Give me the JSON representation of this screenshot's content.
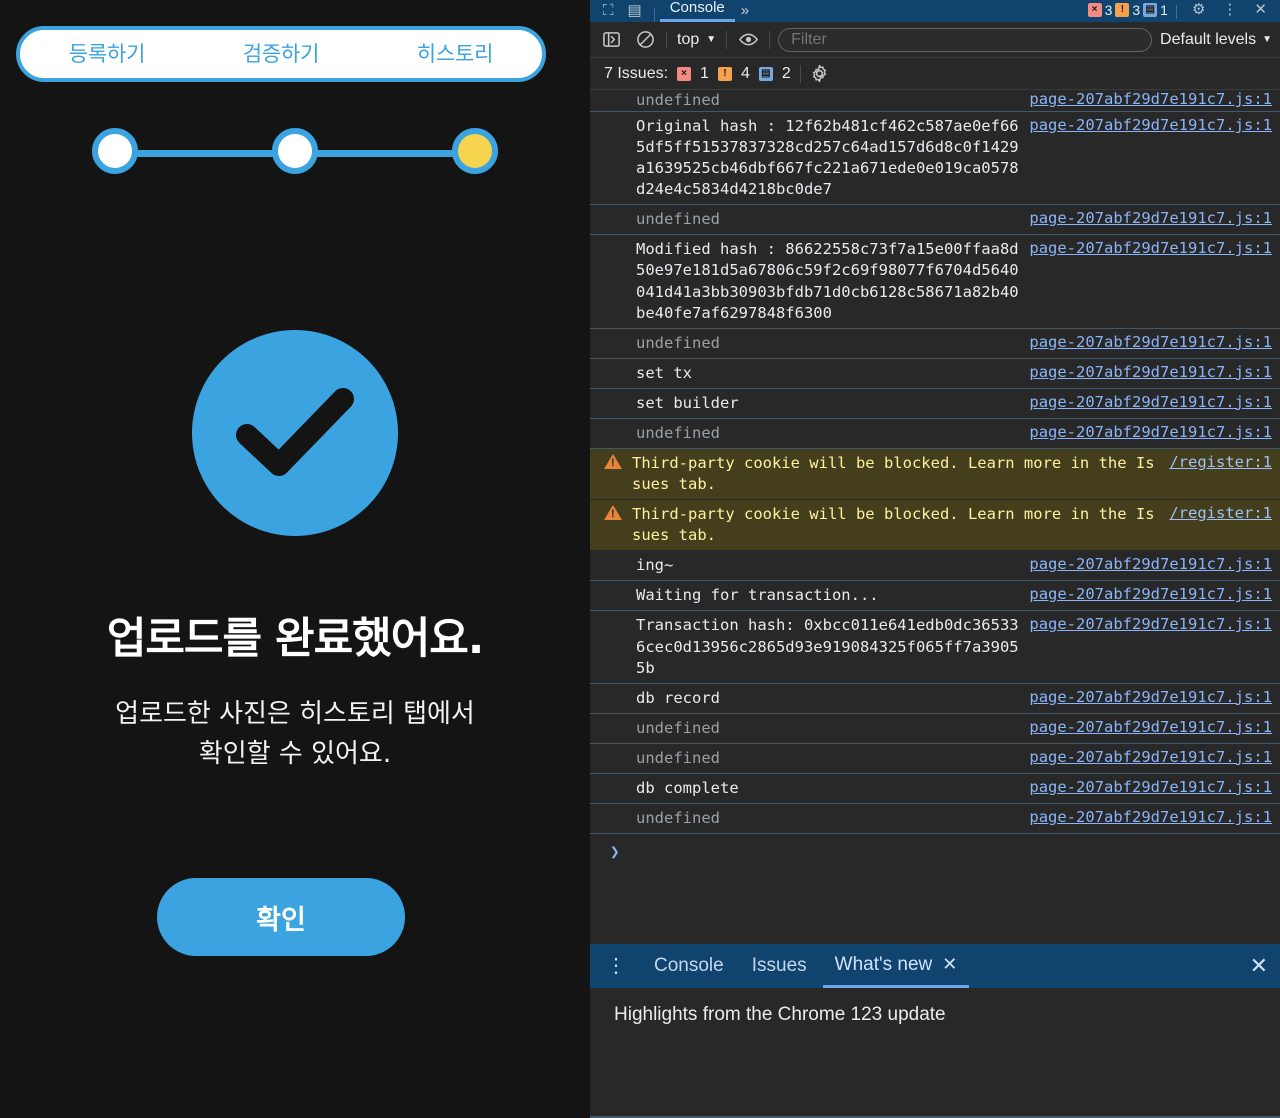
{
  "app": {
    "tabs": [
      {
        "label": "등록하기",
        "active": false
      },
      {
        "label": "검증하기",
        "active": false
      },
      {
        "label": "히스토리",
        "active": true
      }
    ],
    "stepper": {
      "steps": 3,
      "current_index": 2,
      "done_color": "#ffffff",
      "current_color": "#f6d44d",
      "accent": "#3ba3e0"
    },
    "status_icon": "check-circle-icon",
    "headline": "업로드를 완료했어요.",
    "subline_line1": "업로드한 사진은 히스토리 탭에서",
    "subline_line2": "확인할 수 있어요.",
    "confirm_label": "확인",
    "accent_color": "#3ba3e0",
    "background_color": "#141414"
  },
  "devtools": {
    "tabstrip": {
      "inspect_icon": "inspect-element-icon",
      "device_icon": "device-toolbar-icon",
      "tabs": [
        {
          "label": "Console",
          "active": true
        }
      ],
      "more_label": "»",
      "counters": [
        {
          "icon": "error-icon",
          "count": "3",
          "type": "error"
        },
        {
          "icon": "warning-icon",
          "count": "3",
          "type": "warning"
        },
        {
          "icon": "issue-icon",
          "count": "1",
          "type": "info"
        }
      ],
      "settings_icon": "gear-icon",
      "menu_icon": "kebab-menu-icon",
      "close_icon": "close-icon"
    },
    "toolbar": {
      "sidebar_icon": "show-console-sidebar-icon",
      "clear_icon": "clear-console-icon",
      "context_label": "top",
      "context_caret": "▼",
      "eye_icon": "live-expression-eye-icon",
      "filter_placeholder": "Filter",
      "filter_value": "",
      "levels_label": "Default levels",
      "levels_caret": "▼"
    },
    "issuebar": {
      "label": "7 Issues:",
      "errors": "1",
      "warnings": "4",
      "infos": "2",
      "settings_icon": "gear-icon"
    },
    "source_link": "page-207abf29d7e191c7.js:1",
    "register_link": "/register:1",
    "console_rows": [
      {
        "message": "undefined",
        "kind": "undefined",
        "source": "page-207abf29d7e191c7.js:1",
        "clipped": true
      },
      {
        "message": "Original hash : 12f62b481cf462c587ae0ef665df5ff51537837328cd257c64ad157d6d8c0f1429a1639525cb46dbf667fc221a671ede0e019ca0578d24e4c5834d4218bc0de7",
        "kind": "log",
        "source": "page-207abf29d7e191c7.js:1"
      },
      {
        "message": "undefined",
        "kind": "undefined",
        "source": "page-207abf29d7e191c7.js:1"
      },
      {
        "message": "Modified hash : 86622558c73f7a15e00ffaa8d50e97e181d5a67806c59f2c69f98077f6704d5640041d41a3bb30903bfdb71d0cb6128c58671a82b40be40fe7af6297848f6300",
        "kind": "log",
        "source": "page-207abf29d7e191c7.js:1"
      },
      {
        "message": "undefined",
        "kind": "undefined",
        "source": "page-207abf29d7e191c7.js:1"
      },
      {
        "message": "set tx",
        "kind": "log",
        "source": "page-207abf29d7e191c7.js:1"
      },
      {
        "message": "set builder",
        "kind": "log",
        "source": "page-207abf29d7e191c7.js:1"
      },
      {
        "message": "undefined",
        "kind": "undefined",
        "source": "page-207abf29d7e191c7.js:1"
      },
      {
        "message": "Third-party cookie will be blocked. Learn more in the Issues tab.",
        "kind": "warning",
        "source": "/register:1"
      },
      {
        "message": "Third-party cookie will be blocked. Learn more in the Issues tab.",
        "kind": "warning",
        "source": "/register:1"
      },
      {
        "message": "ing~",
        "kind": "log",
        "source": "page-207abf29d7e191c7.js:1"
      },
      {
        "message": "Waiting for transaction...",
        "kind": "log",
        "source": "page-207abf29d7e191c7.js:1"
      },
      {
        "message": "Transaction hash: 0xbcc011e641edb0dc365336cec0d13956c2865d93e919084325f065ff7a39055b",
        "kind": "log",
        "source": "page-207abf29d7e191c7.js:1"
      },
      {
        "message": "db record",
        "kind": "log",
        "source": "page-207abf29d7e191c7.js:1"
      },
      {
        "message": "undefined",
        "kind": "undefined",
        "source": "page-207abf29d7e191c7.js:1"
      },
      {
        "message": "undefined",
        "kind": "undefined",
        "source": "page-207abf29d7e191c7.js:1"
      },
      {
        "message": "db complete",
        "kind": "log",
        "source": "page-207abf29d7e191c7.js:1"
      },
      {
        "message": "undefined",
        "kind": "undefined",
        "source": "page-207abf29d7e191c7.js:1"
      }
    ],
    "prompt_caret": "❯",
    "drawer": {
      "menu_icon": "kebab-menu-icon",
      "tabs": [
        {
          "label": "Console",
          "active": false,
          "closable": false
        },
        {
          "label": "Issues",
          "active": false,
          "closable": false
        },
        {
          "label": "What's new",
          "active": true,
          "closable": true
        }
      ],
      "close_tab_icon": "✕",
      "close_drawer_icon": "✕",
      "body_text": "Highlights from the Chrome 123 update"
    }
  }
}
